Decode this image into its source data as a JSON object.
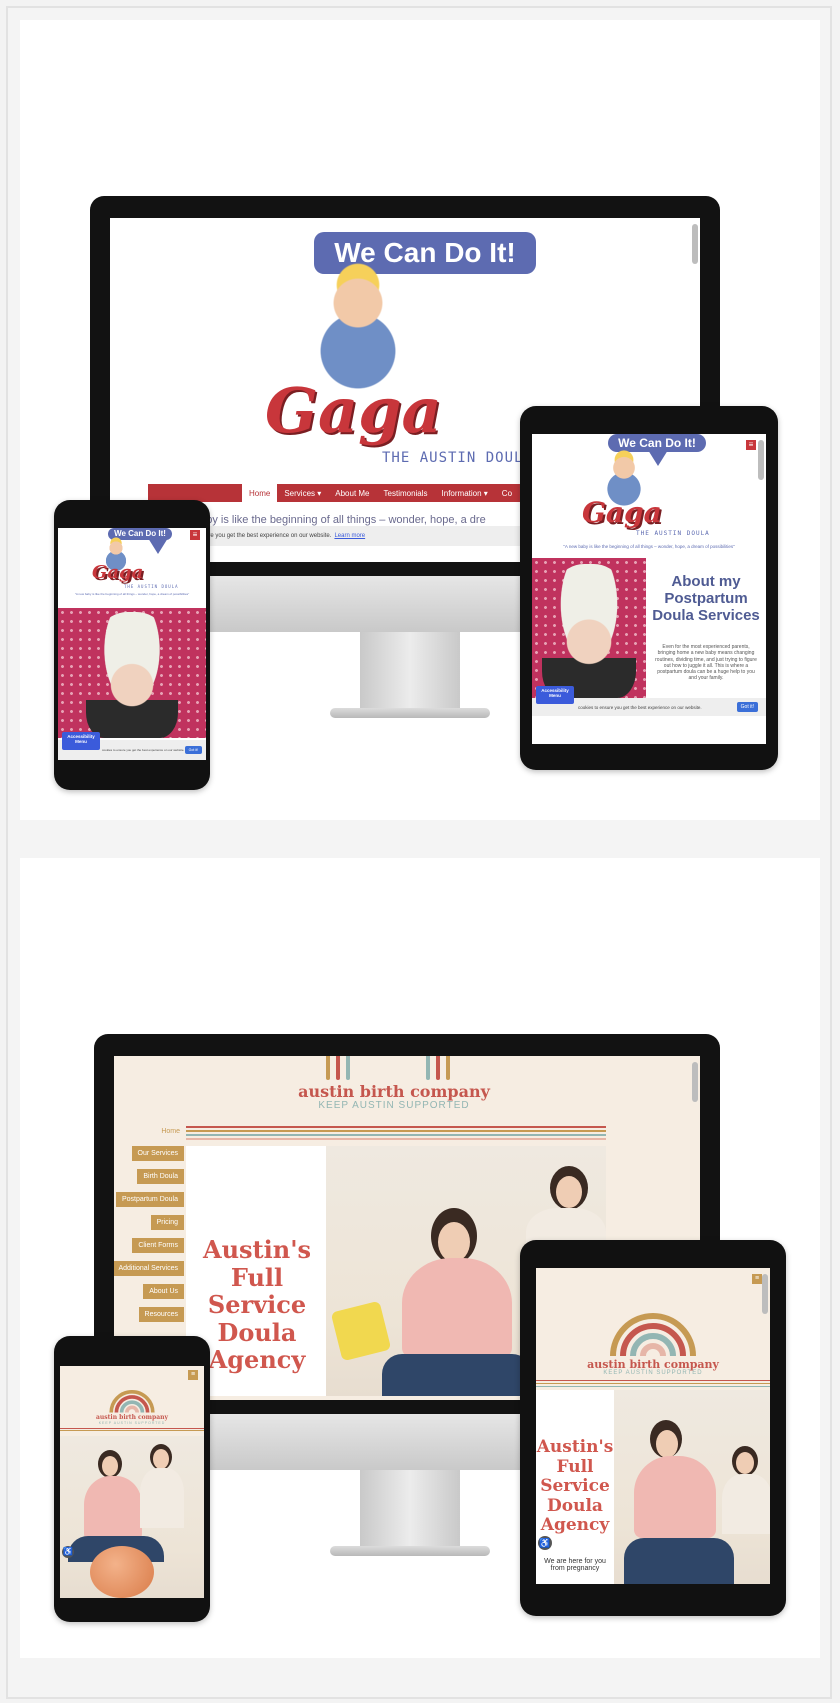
{
  "gaga": {
    "bubble_text": "We Can Do It!",
    "logo_text": "Gaga",
    "subtitle": "THE AUSTIN DOULA",
    "nav": [
      "Home",
      "Services ▾",
      "About Me",
      "Testimonials",
      "Information ▾",
      "Co"
    ],
    "quote": "baby is like the beginning of all things – wonder, hope, a dre",
    "tablet_quote": "\"A new baby is like the beginning of all things – wonder, hope, a dream of possibilities\"",
    "cookie_text": "s to ensure you get the best experience on our website.",
    "cookie_learn": "Learn more",
    "tablet_cookie": "cookies to ensure you get the best experience on our website.",
    "got_it": "Got it!",
    "accessibility": "Accessibility Menu",
    "about_title": "About my Postpartum Doula Services",
    "about_text": "Even for the most experienced parents, bringing home a new baby means changing routines, dividing time, and just trying to figure out how to juggle it all. This is where a postpartum doula can be a huge help to you and your family."
  },
  "austin": {
    "brand": "austin birth company",
    "tagline": "KEEP AUSTIN SUPPORTED",
    "menu": [
      "Home",
      "Our Services",
      "Birth Doula",
      "Postpartum Doula",
      "Pricing",
      "Client Forms",
      "Additional Services",
      "About Us",
      "Resources"
    ],
    "hero": "Austin's Full Service Doula Agency",
    "hero_sub": "We are here for you from pregnancy"
  },
  "colors": {
    "gaga_red": "#b73338",
    "gaga_blue": "#5d6bb1",
    "abc_gold": "#c69a53",
    "abc_coral": "#c5574e"
  },
  "icons": {
    "menu": "hamburger-icon",
    "accessibility": "accessibility-icon"
  }
}
